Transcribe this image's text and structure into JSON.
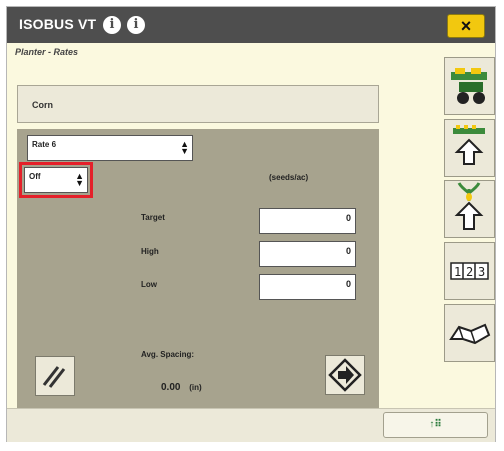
{
  "window": {
    "title": "ISOBUS VT",
    "close_label": "×",
    "page_title": "Planter - Rates",
    "info_icons": [
      "info-icon",
      "info-icon"
    ]
  },
  "crop": {
    "label": "Corn"
  },
  "rate_select": {
    "value": "Rate 6"
  },
  "mode_select": {
    "value": "Off"
  },
  "units": "(seeds/ac)",
  "fields": {
    "target": {
      "label": "Target",
      "value": "0"
    },
    "high": {
      "label": "High",
      "value": "0"
    },
    "low": {
      "label": "Low",
      "value": "0"
    }
  },
  "avg_spacing": {
    "label": "Avg. Spacing:",
    "value": "0.00",
    "unit": "(in)"
  },
  "side_buttons": [
    "planter-icon",
    "row-up-icon",
    "seed-up-icon",
    "number-keypad-icon",
    "book-icon"
  ],
  "bottom_button": {
    "label": "↑⠿"
  },
  "colors": {
    "accent": "#f2c80f",
    "highlight": "#e4202a",
    "panel": "#a7a38e",
    "titlebar": "#4e4e4e"
  }
}
